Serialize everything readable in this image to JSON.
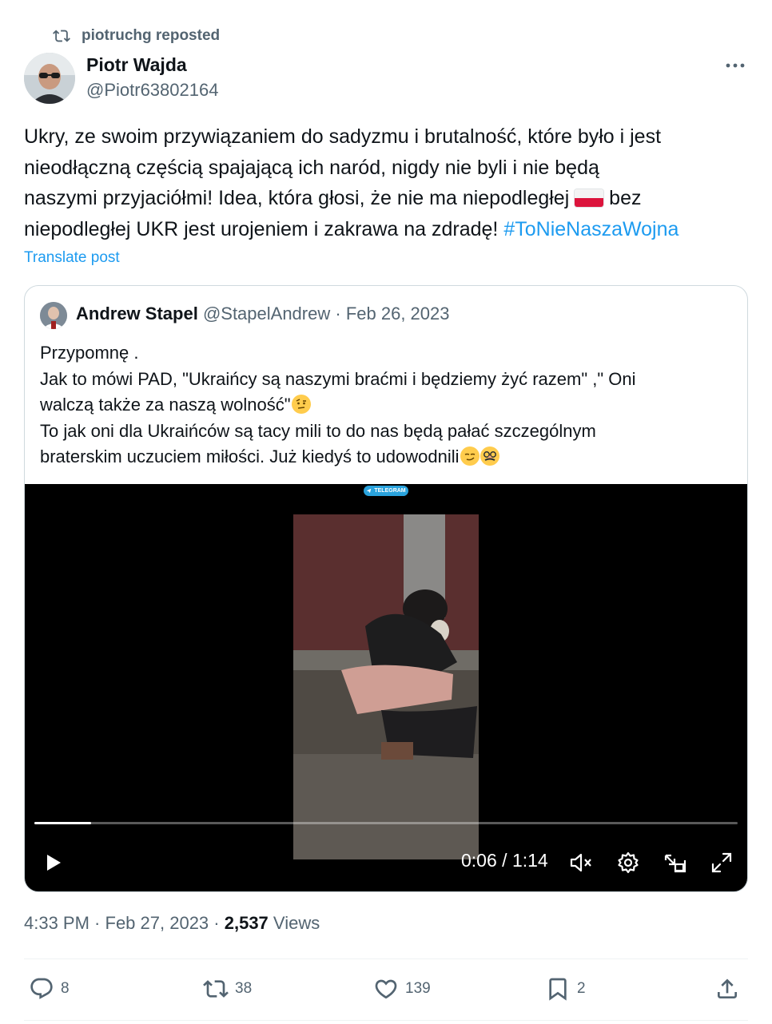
{
  "repost": {
    "label": "piotruchg reposted"
  },
  "author": {
    "name": "Piotr Wajda",
    "handle": "@Piotr63802164"
  },
  "post": {
    "line1": "Ukry, ze swoim przywiązaniem do sadyzmu i brutalność, które było i jest",
    "line2": "nieodłączną częścią spajającą ich naród, nigdy nie byli i nie będą",
    "line3_start": "naszymi przyjaciółmi! Idea, która głosi, że nie ma niepodległej",
    "line3_end": "bez",
    "line4_start": "niepodległej UKR jest urojeniem i zakrawa na zdradę!",
    "hashtag": "#ToNieNaszaWojna",
    "translate_label": "Translate post"
  },
  "quote": {
    "name": "Andrew Stapel",
    "handle": "@StapelAndrew",
    "separator": "·",
    "date": "Feb 26, 2023",
    "line1": "Przypomnę .",
    "line2": "Jak to mówi PAD, \"Ukraińcy  są naszymi braćmi i będziemy żyć razem\" ,\" Oni",
    "line3": "walczą także za naszą wolność\"",
    "line4": "To jak oni dla Ukraińców są tacy mili to do nas  będą pałać szczególnym",
    "line5": "braterskim uczuciem miłości. Już kiedyś to udowodnili",
    "emojis": [
      "face-with-raised-eyebrow",
      "smirking-face",
      "disguised-face"
    ]
  },
  "video": {
    "badge": "TELEGRAM",
    "time_current": "0:06",
    "time_total": "1:14",
    "time_sep": " / ",
    "progress": 0.081,
    "controls": [
      "play-icon",
      "mute-icon",
      "settings-icon",
      "pip-icon",
      "fullscreen-icon"
    ]
  },
  "meta": {
    "time": "4:33 PM",
    "dot": " · ",
    "date": "Feb 27, 2023",
    "views_count": "2,537",
    "views_label": "Views"
  },
  "actions": {
    "replies": "8",
    "reposts": "38",
    "likes": "139",
    "bookmarks": "2"
  },
  "colors": {
    "accent": "#1d9bf0",
    "muted": "#536471",
    "text": "#0f1419",
    "border": "#cfd9de"
  }
}
